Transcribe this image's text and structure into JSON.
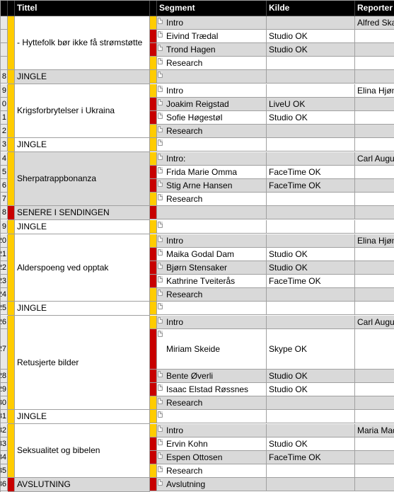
{
  "headers": {
    "c1": "",
    "c2": "",
    "title": "Tittel",
    "seg": "Segment",
    "guest": "Kilde",
    "rep": "Reporter"
  },
  "rows": [
    {
      "n": "",
      "bar1": "y",
      "title": "- Hyttefolk bør ikke få strømstøtte",
      "title_rows": 4,
      "title_bg": "w",
      "seg": [
        {
          "bar": "y",
          "note": true,
          "txt": "Intro",
          "bg": "g",
          "guest": "",
          "rep": "Alfred Ska"
        },
        {
          "bar": "r",
          "note": true,
          "txt": "Eivind Trædal",
          "bg": "w",
          "guest": "Studio OK",
          "rep": ""
        },
        {
          "bar": "r",
          "note": true,
          "txt": "Trond Hagen",
          "bg": "g",
          "guest": "Studio OK",
          "rep": ""
        },
        {
          "bar": "y",
          "note": true,
          "txt": "Research",
          "bg": "w",
          "guest": "",
          "rep": ""
        }
      ]
    },
    {
      "n": "8",
      "bar1": "y",
      "title": "JINGLE",
      "title_rows": 1,
      "title_bg": "g",
      "seg": [
        {
          "bar": "y",
          "note": true,
          "txt": "",
          "bg": "g",
          "guest": "",
          "rep": ""
        }
      ]
    },
    {
      "n": "9",
      "bar1": "y",
      "title": "Krigsforbrytelser i Ukraina",
      "title_rows": 4,
      "title_bg": "w",
      "nums": [
        "9",
        "0",
        "1",
        "2"
      ],
      "seg": [
        {
          "bar": "y",
          "note": true,
          "txt": "Intro",
          "bg": "w",
          "guest": "",
          "rep": "Elina Hjøn"
        },
        {
          "bar": "r",
          "note": true,
          "txt": "Joakim Reigstad",
          "bg": "g",
          "guest": "LiveU OK",
          "rep": ""
        },
        {
          "bar": "r",
          "note": true,
          "txt": "Sofie Høgestøl",
          "bg": "w",
          "guest": "Studio OK",
          "rep": ""
        },
        {
          "bar": "y",
          "note": true,
          "txt": "Research",
          "bg": "g",
          "guest": "",
          "rep": ""
        }
      ]
    },
    {
      "n": "3",
      "bar1": "y",
      "title": "JINGLE",
      "title_rows": 1,
      "title_bg": "w",
      "seg": [
        {
          "bar": "y",
          "note": true,
          "txt": "",
          "bg": "w",
          "guest": "",
          "rep": ""
        }
      ]
    },
    {
      "n": "4",
      "bar1": "y",
      "title": "Sherpatrappbonanza",
      "title_rows": 4,
      "title_bg": "g",
      "nums": [
        "4",
        "5",
        "6",
        "7"
      ],
      "seg": [
        {
          "bar": "y",
          "note": true,
          "txt": "Intro:",
          "bg": "g",
          "guest": "",
          "rep": "Carl Augus"
        },
        {
          "bar": "r",
          "note": true,
          "txt": "Frida Marie Omma",
          "bg": "w",
          "guest": "FaceTime OK",
          "rep": ""
        },
        {
          "bar": "r",
          "note": true,
          "txt": "Stig Arne Hansen",
          "bg": "g",
          "guest": "FaceTime OK",
          "rep": ""
        },
        {
          "bar": "y",
          "note": true,
          "txt": "Research",
          "bg": "w",
          "guest": "",
          "rep": ""
        }
      ]
    },
    {
      "n": "8",
      "bar1": "r",
      "title": "SENERE I SENDINGEN",
      "title_rows": 1,
      "title_bg": "g",
      "seg": [
        {
          "bar": "r",
          "note": false,
          "txt": "",
          "bg": "g",
          "guest": "",
          "rep": ""
        }
      ]
    },
    {
      "n": "9",
      "bar1": "y",
      "title": "JINGLE",
      "title_rows": 1,
      "title_bg": "w",
      "seg": [
        {
          "bar": "y",
          "note": true,
          "txt": "",
          "bg": "w",
          "guest": "",
          "rep": ""
        }
      ]
    },
    {
      "n": "20",
      "bar1": "y",
      "title": "Alderspoeng ved opptak",
      "title_rows": 5,
      "title_bg": "w",
      "nums": [
        "20",
        "21",
        "22",
        "23",
        "24"
      ],
      "seg": [
        {
          "bar": "y",
          "note": true,
          "txt": "Intro",
          "bg": "g",
          "guest": "",
          "rep": "Elina Hjøn"
        },
        {
          "bar": "r",
          "note": true,
          "txt": "Maika Godal Dam",
          "bg": "w",
          "guest": "Studio OK",
          "rep": ""
        },
        {
          "bar": "r",
          "note": true,
          "txt": "Bjørn Stensaker",
          "bg": "g",
          "guest": "Studio OK",
          "rep": ""
        },
        {
          "bar": "r",
          "note": true,
          "txt": "Kathrine Tveiterås",
          "bg": "w",
          "guest": "FaceTime OK",
          "rep": ""
        },
        {
          "bar": "y",
          "note": true,
          "txt": "Research",
          "bg": "g",
          "guest": "",
          "rep": ""
        }
      ]
    },
    {
      "n": "25",
      "bar1": "y",
      "title": "JINGLE",
      "title_rows": 1,
      "title_bg": "w",
      "seg": [
        {
          "bar": "y",
          "note": true,
          "txt": "",
          "bg": "w",
          "guest": "",
          "rep": ""
        }
      ]
    },
    {
      "n": "26",
      "bar1": "y",
      "title": "Retusjerte bilder",
      "title_rows": 5,
      "title_bg": "w",
      "nums": [
        "26",
        "27",
        "28",
        "29",
        "30"
      ],
      "seg": [
        {
          "bar": "y",
          "note": true,
          "txt": "Intro",
          "bg": "g",
          "guest": "",
          "rep": "Carl Augus"
        },
        {
          "bar": "r",
          "note": true,
          "txt": "Miriam Skeide",
          "bg": "w",
          "guest": "Skype OK",
          "rep": "",
          "tall": true
        },
        {
          "bar": "r",
          "note": true,
          "txt": "Bente Øverli",
          "bg": "g",
          "guest": "Studio OK",
          "rep": ""
        },
        {
          "bar": "r",
          "note": true,
          "txt": "Isaac Elstad Røssnes",
          "bg": "w",
          "guest": "Studio OK",
          "rep": ""
        },
        {
          "bar": "y",
          "note": true,
          "txt": "Research",
          "bg": "g",
          "guest": "",
          "rep": ""
        }
      ]
    },
    {
      "n": "31",
      "bar1": "y",
      "title": "JINGLE",
      "title_rows": 1,
      "title_bg": "w",
      "seg": [
        {
          "bar": "y",
          "note": true,
          "txt": "",
          "bg": "w",
          "guest": "",
          "rep": ""
        }
      ]
    },
    {
      "n": "32",
      "bar1": "y",
      "title": "Seksualitet og bibelen",
      "title_rows": 4,
      "title_bg": "w",
      "nums": [
        "32",
        "33",
        "34",
        "35"
      ],
      "seg": [
        {
          "bar": "y",
          "note": true,
          "txt": "Intro",
          "bg": "g",
          "guest": "",
          "rep": "Maria Mad"
        },
        {
          "bar": "r",
          "note": true,
          "txt": "Ervin Kohn",
          "bg": "w",
          "guest": "Studio OK",
          "rep": ""
        },
        {
          "bar": "r",
          "note": true,
          "txt": "Espen Ottosen",
          "bg": "g",
          "guest": "FaceTime OK",
          "rep": ""
        },
        {
          "bar": "y",
          "note": true,
          "txt": "Research",
          "bg": "w",
          "guest": "",
          "rep": ""
        }
      ]
    },
    {
      "n": "36",
      "bar1": "r",
      "title": "AVSLUTNING",
      "title_rows": 1,
      "title_bg": "g",
      "seg": [
        {
          "bar": "r",
          "note": true,
          "txt": "Avslutning",
          "bg": "g",
          "guest": "",
          "rep": ""
        }
      ]
    }
  ]
}
